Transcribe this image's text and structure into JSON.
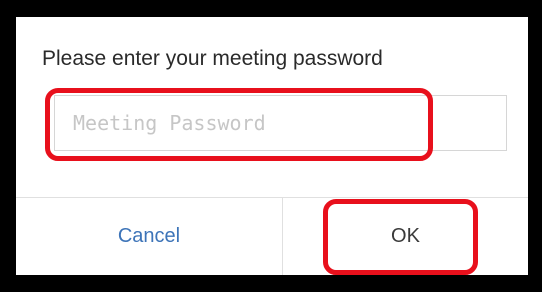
{
  "dialog": {
    "title": "Please enter your meeting password",
    "password_input": {
      "value": "",
      "placeholder": "Meeting Password"
    },
    "buttons": {
      "cancel_label": "Cancel",
      "ok_label": "OK"
    }
  },
  "colors": {
    "background": "#000000",
    "dialog_background": "#ffffff",
    "highlight": "#e8101c",
    "cancel_text": "#3d74b8",
    "ok_text": "#3a3a3a",
    "placeholder_text": "#c6c6c6"
  }
}
